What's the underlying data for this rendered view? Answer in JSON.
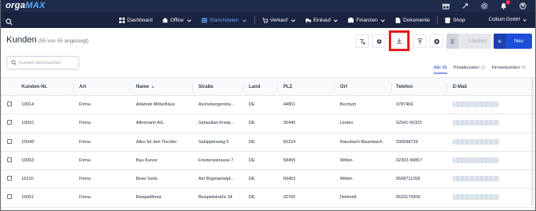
{
  "app": {
    "logo_a": "orga",
    "logo_b": "MAX"
  },
  "nav": {
    "items": [
      {
        "label": "Dashboard",
        "icon": "dashboard-icon",
        "active": false
      },
      {
        "label": "Office",
        "icon": "office-icon",
        "active": false
      },
      {
        "label": "Stammdaten",
        "icon": "stammdaten-icon",
        "active": true
      },
      {
        "label": "Verkauf",
        "icon": "cart-icon",
        "active": false
      },
      {
        "label": "Einkauf",
        "icon": "truck-icon",
        "active": false
      },
      {
        "label": "Finanzen",
        "icon": "finance-icon",
        "active": false
      },
      {
        "label": "Dokumente",
        "icon": "document-icon",
        "active": false
      },
      {
        "label": "Shop",
        "icon": "shop-icon",
        "active": false
      }
    ],
    "company": "Coltium GmbH",
    "notification_count": "1"
  },
  "page": {
    "title": "Kunden",
    "subtitle": "(55 von 55 angezeigt)",
    "delete_label": "Löschen",
    "new_label": "Neu"
  },
  "search": {
    "placeholder": "Kunden durchsuchen"
  },
  "filters": [
    {
      "label": "Alle",
      "count": "55",
      "active": true
    },
    {
      "label": "Privatkunden",
      "count": "10",
      "active": false
    },
    {
      "label": "Firmenkunden",
      "count": "45",
      "active": false
    }
  ],
  "table": {
    "headers": [
      "Kunden-Nr.",
      "Art",
      "Name",
      "Straße",
      "Land",
      "PLZ",
      "Ort",
      "Telefon",
      "E-Mail"
    ],
    "rows": [
      [
        "10014",
        "Firma",
        "Adamek Möbelhäus",
        "Aschebergerstra...",
        "DE",
        "44801",
        "Bochum",
        "9787469"
      ],
      [
        "10010",
        "Firma",
        "Alfermann AG",
        "Sebastian-Kneip...",
        "DE",
        "35440",
        "Linden",
        "02541-56325"
      ],
      [
        "10048",
        "Firma",
        "Alles für den Tischler",
        "Saloppenweg 5",
        "DE",
        "56224",
        "Ransbach-Baumbach",
        "336698726"
      ],
      [
        "10053",
        "Firma",
        "Bau Kunze",
        "Friedensstrasse 7",
        "DE",
        "58455",
        "Witten",
        "02302-99857"
      ],
      [
        "10110",
        "Firma",
        "Beier Gebr.",
        "Am Bügmantelpl...",
        "DE",
        "58453",
        "Witten",
        "0568711258"
      ],
      [
        "10051",
        "Firma",
        "Beispielfirma",
        "Beispielstraße 34",
        "DE",
        "32760",
        "Detmold",
        "0523170900"
      ]
    ]
  },
  "colors": {
    "topbar": "#1e2a4a",
    "navbar": "#1a2340",
    "accent": "#1d4ed8",
    "highlight": "#e11d1d"
  }
}
